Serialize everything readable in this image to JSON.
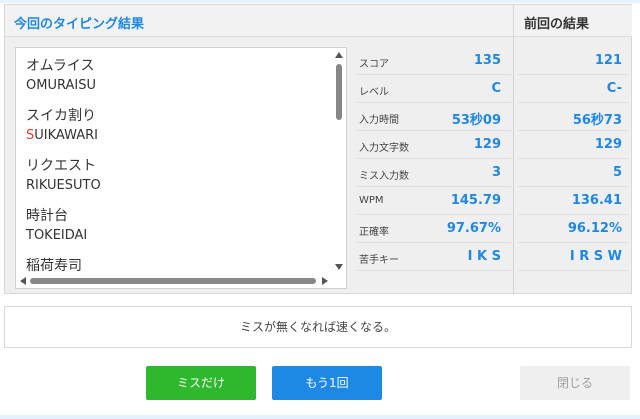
{
  "header": {
    "current_title": "今回のタイピング結果",
    "previous_title": "前回の結果"
  },
  "words": [
    {
      "kana": "オムライス",
      "romaji": "OMURAISU",
      "miss_prefix": "",
      "romaji_rest": "OMURAISU"
    },
    {
      "kana": "スイカ割り",
      "romaji": "SUIKAWARI",
      "miss_prefix": "S",
      "romaji_rest": "UIKAWARI"
    },
    {
      "kana": "リクエスト",
      "romaji": "RIKUESUTO",
      "miss_prefix": "",
      "romaji_rest": "RIKUESUTO"
    },
    {
      "kana": "時計台",
      "romaji": "TOKEIDAI",
      "miss_prefix": "",
      "romaji_rest": "TOKEIDAI"
    },
    {
      "kana": "稲荷寿司",
      "romaji": "",
      "miss_prefix": "",
      "romaji_rest": ""
    }
  ],
  "stats": {
    "labels": [
      "スコア",
      "レベル",
      "入力時間",
      "入力文字数",
      "ミス入力数",
      "WPM",
      "正確率",
      "苦手キー"
    ],
    "current": [
      "135",
      "C",
      "53秒09",
      "129",
      "3",
      "145.79",
      "97.67%",
      "I K S"
    ],
    "previous": [
      "121",
      "C-",
      "56秒73",
      "129",
      "5",
      "136.41",
      "96.12%",
      "I R S W"
    ]
  },
  "message": "ミスが無くなれば速くなる。",
  "buttons": {
    "miss_only": "ミスだけ",
    "again": "もう1回",
    "close": "閉じる"
  },
  "colors": {
    "accent": "#1e88e5",
    "miss_button": "#2eb82e",
    "miss_char": "#e53935"
  },
  "icons": [
    "scroll-up-arrow-icon",
    "scroll-down-arrow-icon",
    "scroll-left-arrow-icon",
    "scroll-right-arrow-icon"
  ]
}
